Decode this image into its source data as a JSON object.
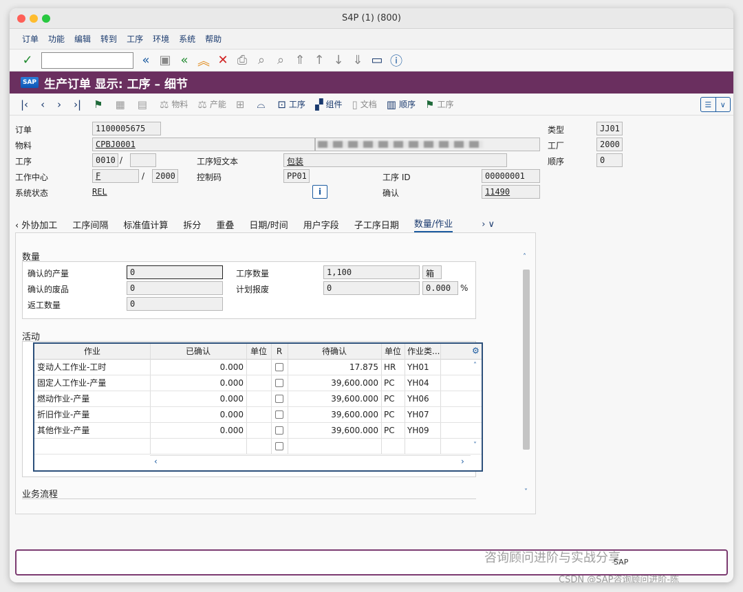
{
  "window": {
    "title": "S4P (1) (800)"
  },
  "menu": [
    "订单",
    "功能",
    "编辑",
    "转到",
    "工序",
    "环境",
    "系统",
    "帮助"
  ],
  "header": {
    "logo": "SAP",
    "title": "生产订单 显示: 工序 – 细节"
  },
  "toolbar2": {
    "material": "物料",
    "capacity": "产能",
    "operation": "工序",
    "component": "组件",
    "document": "文档",
    "sequence": "顺序",
    "operation2": "工序"
  },
  "form": {
    "order_label": "订单",
    "order_value": "1100005675",
    "material_label": "物料",
    "material_value": "CPBJ0001",
    "operation_label": "工序",
    "operation_value": "0010",
    "operation_sep": "/",
    "operation_sub": "",
    "op_short_text_label": "工序短文本",
    "op_short_text_value": "包装",
    "work_center_label": "工作中心",
    "work_center_value": "F",
    "work_center_sep": "/",
    "work_center_plant": "2000",
    "control_key_label": "控制码",
    "control_key_value": "PP01",
    "op_id_label": "工序 ID",
    "op_id_value": "00000001",
    "status_label": "系统状态",
    "status_value": "REL",
    "confirm_label": "确认",
    "confirm_value": "11490",
    "type_label": "类型",
    "type_value": "JJ01",
    "plant_label": "工厂",
    "plant_value": "2000",
    "seq_label": "顺序",
    "seq_value": "0"
  },
  "tabs": [
    "‹ 外协加工",
    "工序间隔",
    "标准值计算",
    "拆分",
    "重叠",
    "日期/时间",
    "用户字段",
    "子工序日期",
    "数量/作业"
  ],
  "tabs_more": "› ∨",
  "quantity": {
    "title": "数量",
    "confirmed_yield_label": "确认的产量",
    "confirmed_yield": "0",
    "confirmed_scrap_label": "确认的废品",
    "confirmed_scrap": "0",
    "rework_label": "返工数量",
    "rework": "0",
    "op_qty_label": "工序数量",
    "op_qty": "1,100",
    "op_unit": "箱",
    "planned_scrap_label": "计划报废",
    "planned_scrap": "0",
    "planned_scrap_pct": "0.000",
    "pct": "%"
  },
  "activities": {
    "title": "活动",
    "columns": [
      "作业",
      "已确认",
      "单位",
      "R",
      "待确认",
      "单位",
      "作业类..."
    ],
    "rows": [
      {
        "name": "变动人工作业-工时",
        "confirmed": "0.000",
        "pending": "17.875",
        "unit": "HR",
        "type": "YH01"
      },
      {
        "name": "固定人工作业-产量",
        "confirmed": "0.000",
        "pending": "39,600.000",
        "unit": "PC",
        "type": "YH04"
      },
      {
        "name": "燃动作业-产量",
        "confirmed": "0.000",
        "pending": "39,600.000",
        "unit": "PC",
        "type": "YH06"
      },
      {
        "name": "折旧作业-产量",
        "confirmed": "0.000",
        "pending": "39,600.000",
        "unit": "PC",
        "type": "YH07"
      },
      {
        "name": "其他作业-产量",
        "confirmed": "0.000",
        "pending": "39,600.000",
        "unit": "PC",
        "type": "YH09"
      }
    ]
  },
  "business_flow": {
    "title": "业务流程"
  },
  "status": {
    "sap": "SAP",
    "watermark1": "咨询顾问进阶与实战分享",
    "watermark2": "CSDN @SAP咨询顾问进阶-陈"
  }
}
